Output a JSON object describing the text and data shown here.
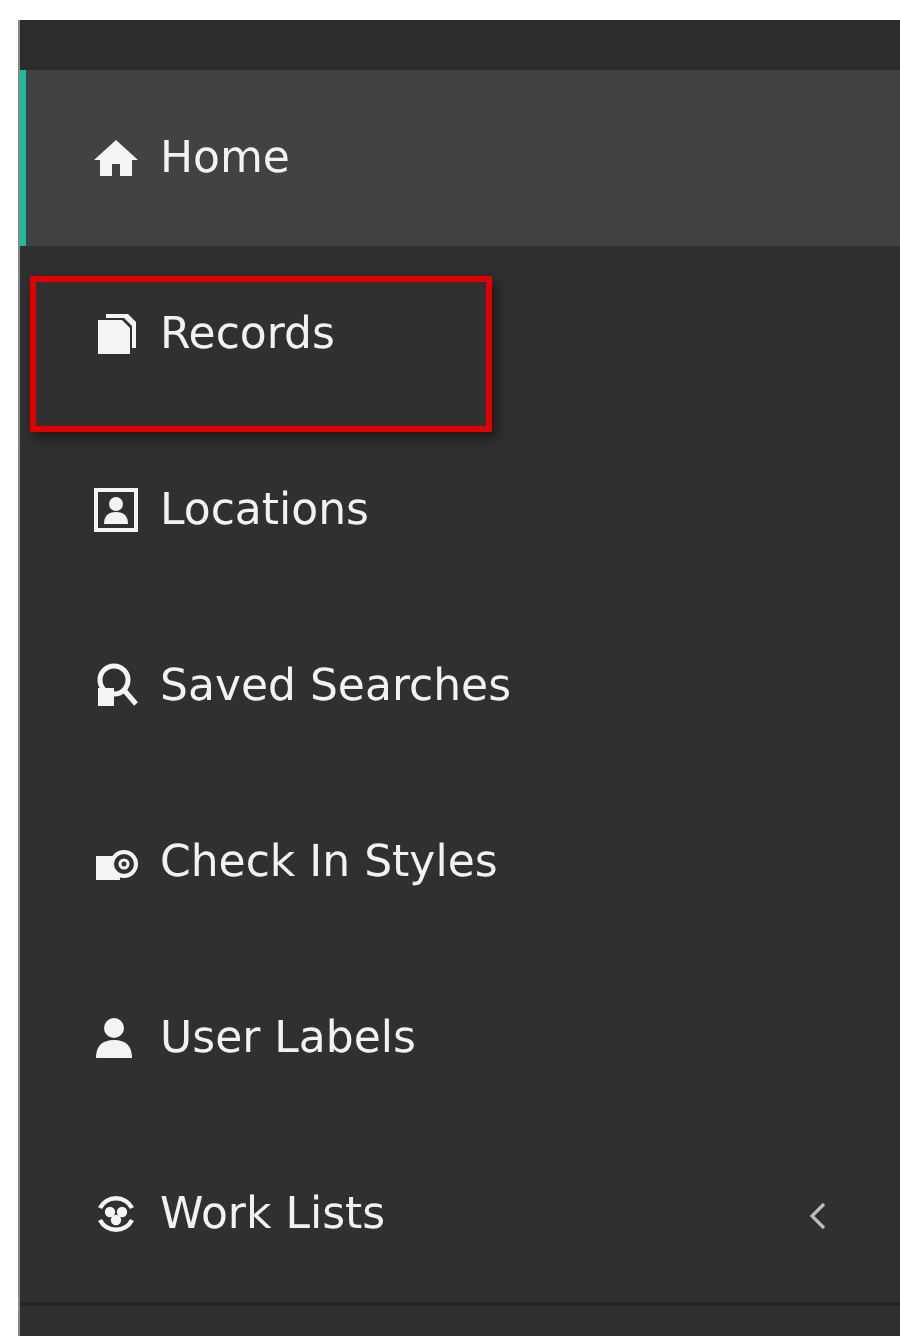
{
  "sidebar": {
    "items": [
      {
        "label": "Home",
        "selected": true,
        "highlighted": false,
        "expandable": false
      },
      {
        "label": "Records",
        "selected": false,
        "highlighted": true,
        "expandable": false
      },
      {
        "label": "Locations",
        "selected": false,
        "highlighted": false,
        "expandable": false
      },
      {
        "label": "Saved Searches",
        "selected": false,
        "highlighted": false,
        "expandable": false
      },
      {
        "label": "Check In Styles",
        "selected": false,
        "highlighted": false,
        "expandable": false
      },
      {
        "label": "User Labels",
        "selected": false,
        "highlighted": false,
        "expandable": false
      },
      {
        "label": "Work Lists",
        "selected": false,
        "highlighted": false,
        "expandable": true
      }
    ]
  }
}
